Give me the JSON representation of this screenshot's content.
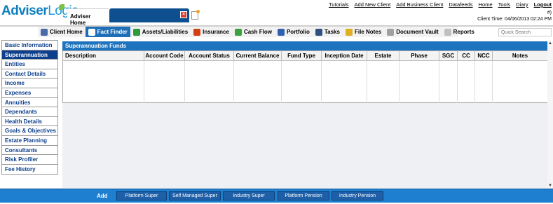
{
  "logo": {
    "brand_a": "Adviser",
    "brand_b": "Logic",
    "tagline": ""
  },
  "tabs": {
    "adviser_home": "Adviser Home"
  },
  "toplinks": [
    "Tutorials",
    "Add New Client",
    "Add Business Client",
    "Datafeeds",
    "Home",
    "Tools",
    "Diary"
  ],
  "logout": "Logout",
  "user_line": "#)",
  "client_time": "Client Time: 04/06/2013 02:24 PM",
  "nav": [
    {
      "label": "Client Home",
      "icon": "home-icon",
      "color": "#4a6aa8"
    },
    {
      "label": "Fact Finder",
      "icon": "fact-finder-icon",
      "color": "#ffffff",
      "active": true
    },
    {
      "label": "Assets/Liabilities",
      "icon": "assets-icon",
      "color": "#2e9a3a"
    },
    {
      "label": "Insurance",
      "icon": "insurance-icon",
      "color": "#d04010"
    },
    {
      "label": "Cash Flow",
      "icon": "cash-flow-icon",
      "color": "#3aa040"
    },
    {
      "label": "Portfolio",
      "icon": "portfolio-icon",
      "color": "#3060b0"
    },
    {
      "label": "Tasks",
      "icon": "tasks-icon",
      "color": "#305080"
    },
    {
      "label": "File Notes",
      "icon": "file-notes-icon",
      "color": "#e0b020"
    },
    {
      "label": "Document Vault",
      "icon": "document-vault-icon",
      "color": "#a0a0a0"
    },
    {
      "label": "Reports",
      "icon": "reports-icon",
      "color": "#c0c0c0"
    }
  ],
  "quick_search_placeholder": "Quick Search",
  "sidebar": [
    "Basic Information",
    "Superannuation",
    "Entities",
    "Contact Details",
    "Income",
    "Expenses",
    "Annuities",
    "Dependants",
    "Health Details",
    "Goals & Objectives",
    "Estate Planning",
    "Consultants",
    "Risk Profiler",
    "Fee History"
  ],
  "sidebar_active": 1,
  "panel": {
    "title": "Superannuation Funds",
    "columns": [
      "Description",
      "Account Code",
      "Account Status",
      "Current Balance",
      "Fund Type",
      "Inception Date",
      "Estate",
      "Phase",
      "SGC",
      "CC",
      "NCC",
      "Notes"
    ]
  },
  "footer": {
    "add_label": "Add",
    "buttons": [
      "Platform Super",
      "Self Managed Super",
      "Industry Super",
      "Platform Pension",
      "Industry Pension"
    ]
  }
}
